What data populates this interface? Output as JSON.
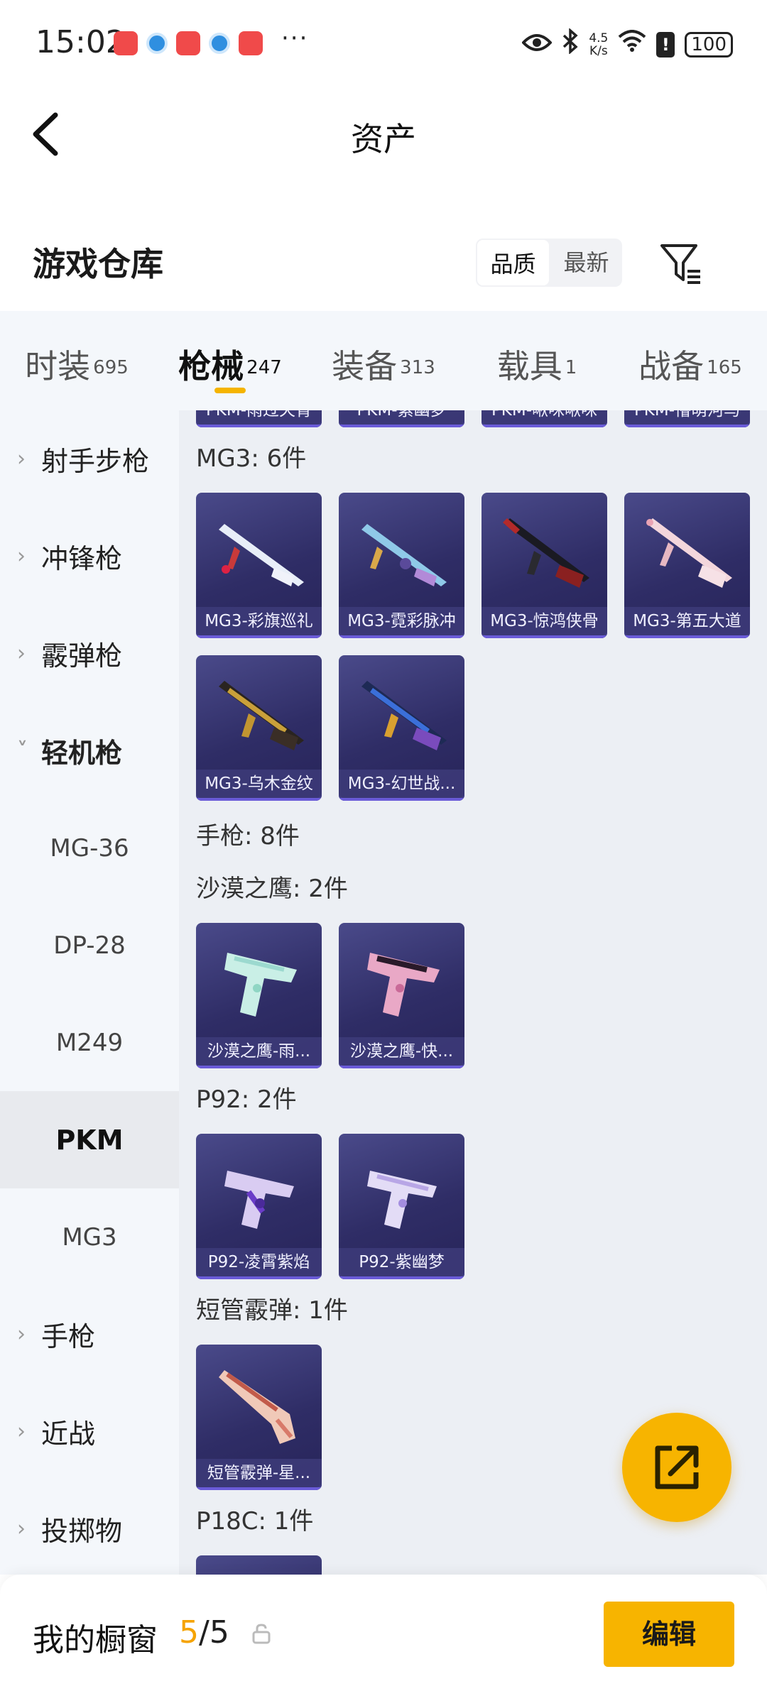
{
  "status_bar": {
    "time": "15:02",
    "more": "···",
    "net_speed_value": "4.5",
    "net_speed_unit": "K/s",
    "battery": "100"
  },
  "header": {
    "title": "资产"
  },
  "warehouse": {
    "title": "游戏仓库",
    "sort_options": [
      "品质",
      "最新"
    ],
    "sort_selected": "品质"
  },
  "tabs": [
    {
      "label": "时装",
      "count": "695"
    },
    {
      "label": "枪械",
      "count": "247",
      "active": true
    },
    {
      "label": "装备",
      "count": "313"
    },
    {
      "label": "载具",
      "count": "1"
    },
    {
      "label": "战备",
      "count": "165"
    }
  ],
  "sidebar": {
    "items": [
      {
        "label": "射手步枪",
        "type": "parent"
      },
      {
        "label": "冲锋枪",
        "type": "parent"
      },
      {
        "label": "霰弹枪",
        "type": "parent"
      },
      {
        "label": "轻机枪",
        "type": "parent-expanded"
      },
      {
        "label": "MG-36",
        "type": "sub"
      },
      {
        "label": "DP-28",
        "type": "sub"
      },
      {
        "label": "M249",
        "type": "sub"
      },
      {
        "label": "PKM",
        "type": "sub-selected"
      },
      {
        "label": "MG3",
        "type": "sub"
      },
      {
        "label": "手枪",
        "type": "parent"
      },
      {
        "label": "近战",
        "type": "parent"
      },
      {
        "label": "投掷物",
        "type": "parent"
      }
    ]
  },
  "main": {
    "pkm_stub_items": [
      "PKM-雨过天青",
      "PKM-紫幽梦",
      "PKM-啾咪啾咪",
      "PKM-懵萌河马"
    ],
    "sections": [
      {
        "title": "MG3: 6件",
        "items": [
          "MG3-彩旗巡礼",
          "MG3-霓彩脉冲",
          "MG3-惊鸿侠骨",
          "MG3-第五大道",
          "MG3-乌木金纹",
          "MG3-幻世战..."
        ]
      },
      {
        "title": "手枪: 8件",
        "items": []
      },
      {
        "title": "沙漠之鹰: 2件",
        "items": [
          "沙漠之鹰-雨...",
          "沙漠之鹰-快..."
        ]
      },
      {
        "title": "P92: 2件",
        "items": [
          "P92-凌霄紫焰",
          "P92-紫幽梦"
        ]
      },
      {
        "title": "短管霰弹: 1件",
        "items": [
          "短管霰弹-星..."
        ]
      },
      {
        "title": "P18C: 1件",
        "items": []
      }
    ]
  },
  "bottom_bar": {
    "title": "我的橱窗",
    "count_current": "5",
    "count_sep_total": "/5",
    "edit_label": "编辑"
  },
  "colors": {
    "accent": "#f7b400",
    "card_bg": "#2f2d66",
    "panel_bg": "#f4f7fb"
  }
}
